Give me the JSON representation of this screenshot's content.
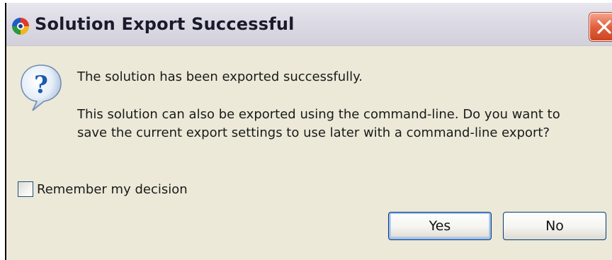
{
  "dialog": {
    "title": "Solution Export Successful",
    "message_line1": "The solution has been exported successfully.",
    "message_line2a": "This solution can also be exported using the command-line. Do you want to",
    "message_line2b": "save the current export settings to use later with a command-line export?",
    "checkbox_label": "Remember my decision",
    "checkbox_checked": false,
    "yes_label": "Yes",
    "no_label": "No",
    "default_button": "Yes"
  },
  "icons": {
    "app": "app-logo-icon",
    "close": "close-icon",
    "question": "question-icon"
  },
  "colors": {
    "dialog_bg": "#ece9d8",
    "close_button": "#e2603f",
    "question_icon": "#1a5bb0",
    "button_border": "#003c74"
  }
}
